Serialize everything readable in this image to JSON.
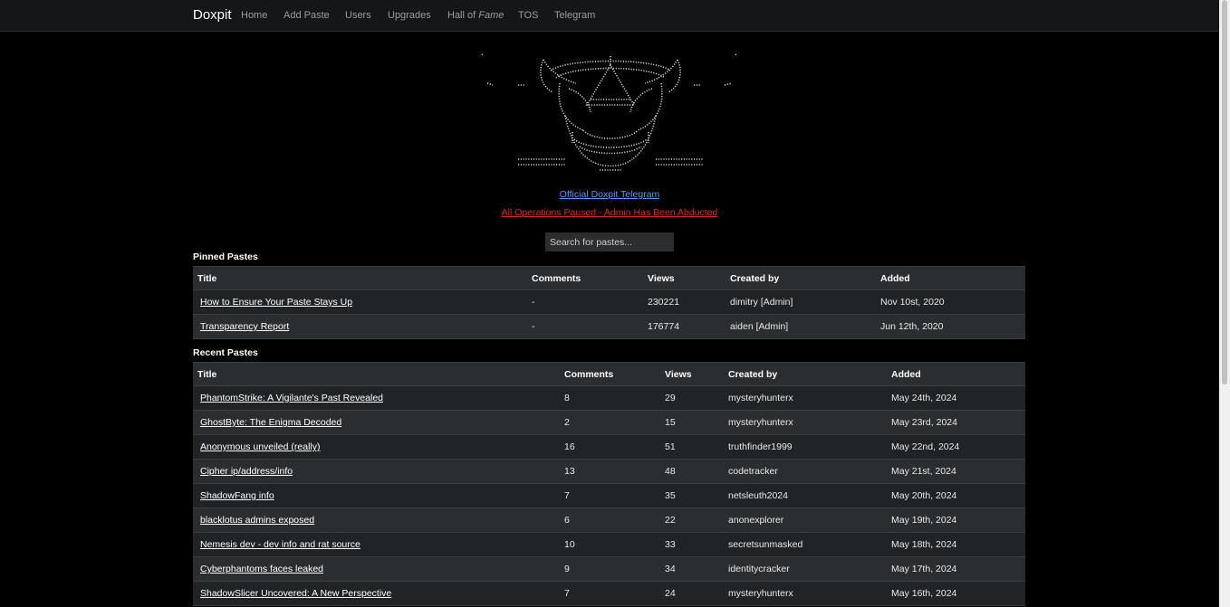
{
  "nav": {
    "brand": "Doxpit",
    "items": [
      {
        "label": "Home"
      },
      {
        "label": "Add Paste"
      },
      {
        "label": "Users"
      },
      {
        "label": "Upgrades"
      },
      {
        "label_prefix": "Hall of ",
        "label_em": "Fame"
      },
      {
        "label": "TOS"
      },
      {
        "label": "Telegram"
      }
    ]
  },
  "banner": {
    "telegram_link": "Official Doxpit Telegram",
    "notice_link": "All Operations Paused - Admin Has Been Abducted"
  },
  "search": {
    "placeholder": "Search for pastes..."
  },
  "pinned": {
    "title": "Pinned Pastes",
    "columns": [
      "Title",
      "Comments",
      "Views",
      "Created by",
      "Added"
    ],
    "rows": [
      {
        "title": "How to Ensure Your Paste Stays Up",
        "comments": "-",
        "views": "230221",
        "author": "dimitry [Admin]",
        "added": "Nov 10st, 2020"
      },
      {
        "title": "Transparency Report",
        "comments": "-",
        "views": "176774",
        "author": "aiden [Admin]",
        "added": "Jun 12th, 2020"
      }
    ]
  },
  "recent": {
    "title": "Recent Pastes",
    "columns": [
      "Title",
      "Comments",
      "Views",
      "Created by",
      "Added"
    ],
    "rows": [
      {
        "title": "PhantomStrike: A Vigilante's Past Revealed",
        "comments": "8",
        "views": "29",
        "author": "mysteryhunterx",
        "added": "May 24th, 2024"
      },
      {
        "title": "GhostByte: The Enigma Decoded",
        "comments": "2",
        "views": "15",
        "author": "mysteryhunterx",
        "added": "May 23rd, 2024"
      },
      {
        "title": "Anonymous unveiled (really)",
        "comments": "16",
        "views": "51",
        "author": "truthfinder1999",
        "added": "May 22nd, 2024"
      },
      {
        "title": "Cipher ip/address/info",
        "comments": "13",
        "views": "48",
        "author": "codetracker",
        "added": "May 21st, 2024"
      },
      {
        "title": "ShadowFang info",
        "comments": "7",
        "views": "35",
        "author": "netsleuth2024",
        "added": "May 20th, 2024"
      },
      {
        "title": "blacklotus admins exposed",
        "comments": "6",
        "views": "22",
        "author": "anonexplorer",
        "added": "May 19th, 2024"
      },
      {
        "title": "Nemesis dev - dev info and rat source",
        "comments": "10",
        "views": "33",
        "author": "secretsunmasked",
        "added": "May 18th, 2024"
      },
      {
        "title": "Cyberphantoms faces leaked",
        "comments": "9",
        "views": "34",
        "author": "identitycracker",
        "added": "May 17th, 2024"
      },
      {
        "title": "ShadowSlicer Uncovered: A New Perspective",
        "comments": "7",
        "views": "24",
        "author": "mysteryhunterx",
        "added": "May 16th, 2024"
      }
    ]
  }
}
